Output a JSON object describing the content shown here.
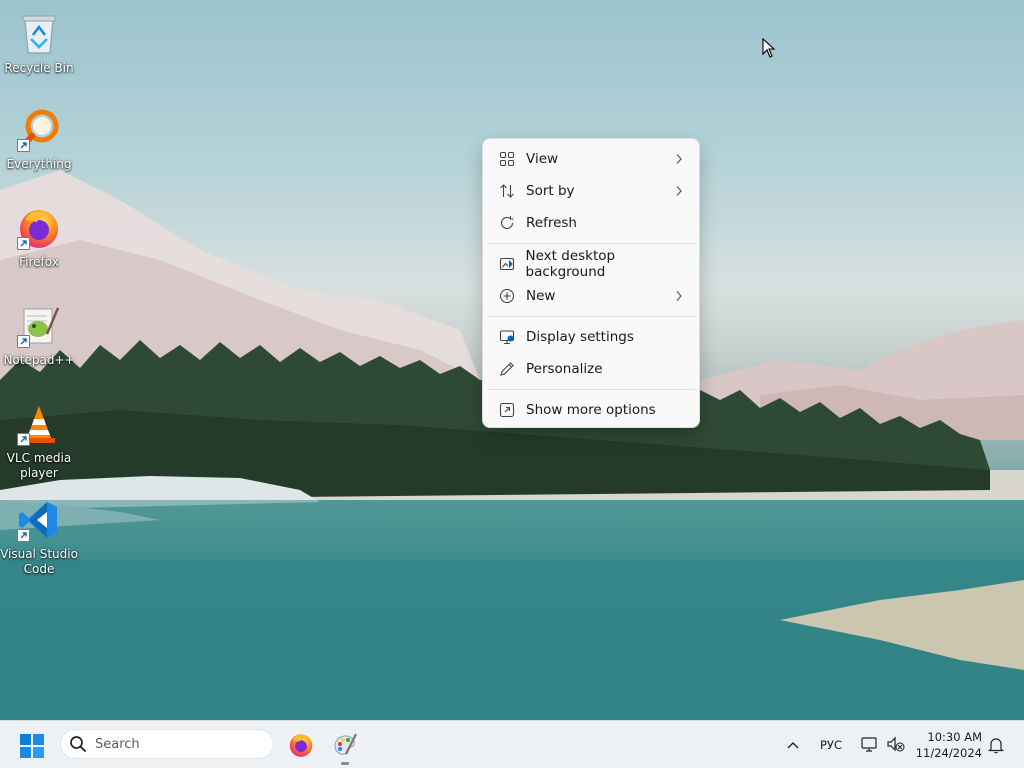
{
  "desktop": {
    "icons": [
      {
        "label": "Recycle Bin",
        "icon": "recycle-bin-icon"
      },
      {
        "label": "Everything",
        "icon": "everything-search-icon"
      },
      {
        "label": "Firefox",
        "icon": "firefox-icon"
      },
      {
        "label": "Notepad++",
        "icon": "notepad-plus-plus-icon"
      },
      {
        "label_line1": "VLC media",
        "label_line2": "player",
        "icon": "vlc-icon"
      },
      {
        "label_line1": "Visual Studio",
        "label_line2": "Code",
        "icon": "vscode-icon"
      }
    ]
  },
  "context_menu": {
    "items": [
      {
        "label": "View",
        "icon": "grid-view-icon",
        "submenu": true
      },
      {
        "label": "Sort by",
        "icon": "sort-icon",
        "submenu": true
      },
      {
        "label": "Refresh",
        "icon": "refresh-icon",
        "submenu": false
      },
      {
        "label": "Next desktop background",
        "icon": "next-background-icon",
        "submenu": false
      },
      {
        "label": "New",
        "icon": "new-plus-icon",
        "submenu": true
      },
      {
        "label": "Display settings",
        "icon": "display-settings-icon",
        "submenu": false
      },
      {
        "label": "Personalize",
        "icon": "pen-icon",
        "submenu": false
      },
      {
        "label": "Show more options",
        "icon": "show-more-icon",
        "submenu": false
      }
    ]
  },
  "taskbar": {
    "search_placeholder": "Search",
    "pinned": [
      "firefox-icon",
      "paint-icon"
    ],
    "language": "РУС",
    "time": "10:30 AM",
    "date": "11/24/2024"
  },
  "colors": {
    "accent": "#0067c0",
    "menu_bg": "#f9f9f9",
    "taskbar_bg": "#eef1f4"
  }
}
